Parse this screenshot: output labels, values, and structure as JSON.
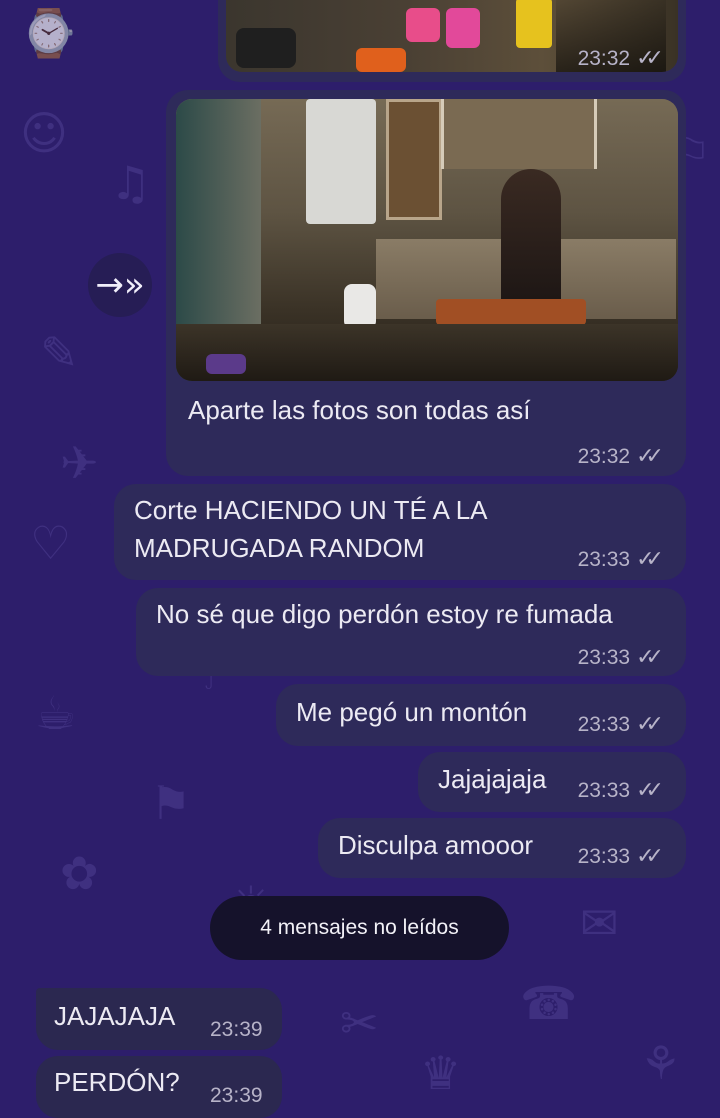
{
  "wallpaper_icons": [
    "☺",
    "✎",
    "♡",
    "☕",
    "✿",
    "⚑",
    "☂",
    "✈",
    "♫",
    "⌚",
    "✉",
    "☎",
    "⚘",
    "✂",
    "♛",
    "☼",
    "⚐",
    "☁"
  ],
  "photo_top": {
    "time": "23:32"
  },
  "forward_icon": "→»",
  "photo_message": {
    "text": "Aparte las fotos son todas así",
    "time": "23:32"
  },
  "messages_out": [
    {
      "lines": [
        "Corte HACIENDO UN TÉ A LA",
        "MADRUGADA RANDOM"
      ],
      "time": "23:33"
    },
    {
      "lines": [
        "No sé que digo perdón estoy re fumada"
      ],
      "time": "23:33"
    },
    {
      "lines": [
        "Me pegó un montón"
      ],
      "time": "23:33"
    },
    {
      "lines": [
        "Jajajajaja"
      ],
      "time": "23:33"
    },
    {
      "lines": [
        "Disculpa amooor"
      ],
      "time": "23:33"
    }
  ],
  "unread_banner": "4 mensajes no leídos",
  "messages_in": [
    {
      "text": "JAJAJAJA",
      "time": "23:39"
    },
    {
      "text": "PERDÓN?",
      "time": "23:39"
    }
  ],
  "colors": {
    "background": "#2d1e6b",
    "bubble": "#2e2a5a",
    "text": "#eceaf3",
    "time": "#b7b3c8"
  }
}
